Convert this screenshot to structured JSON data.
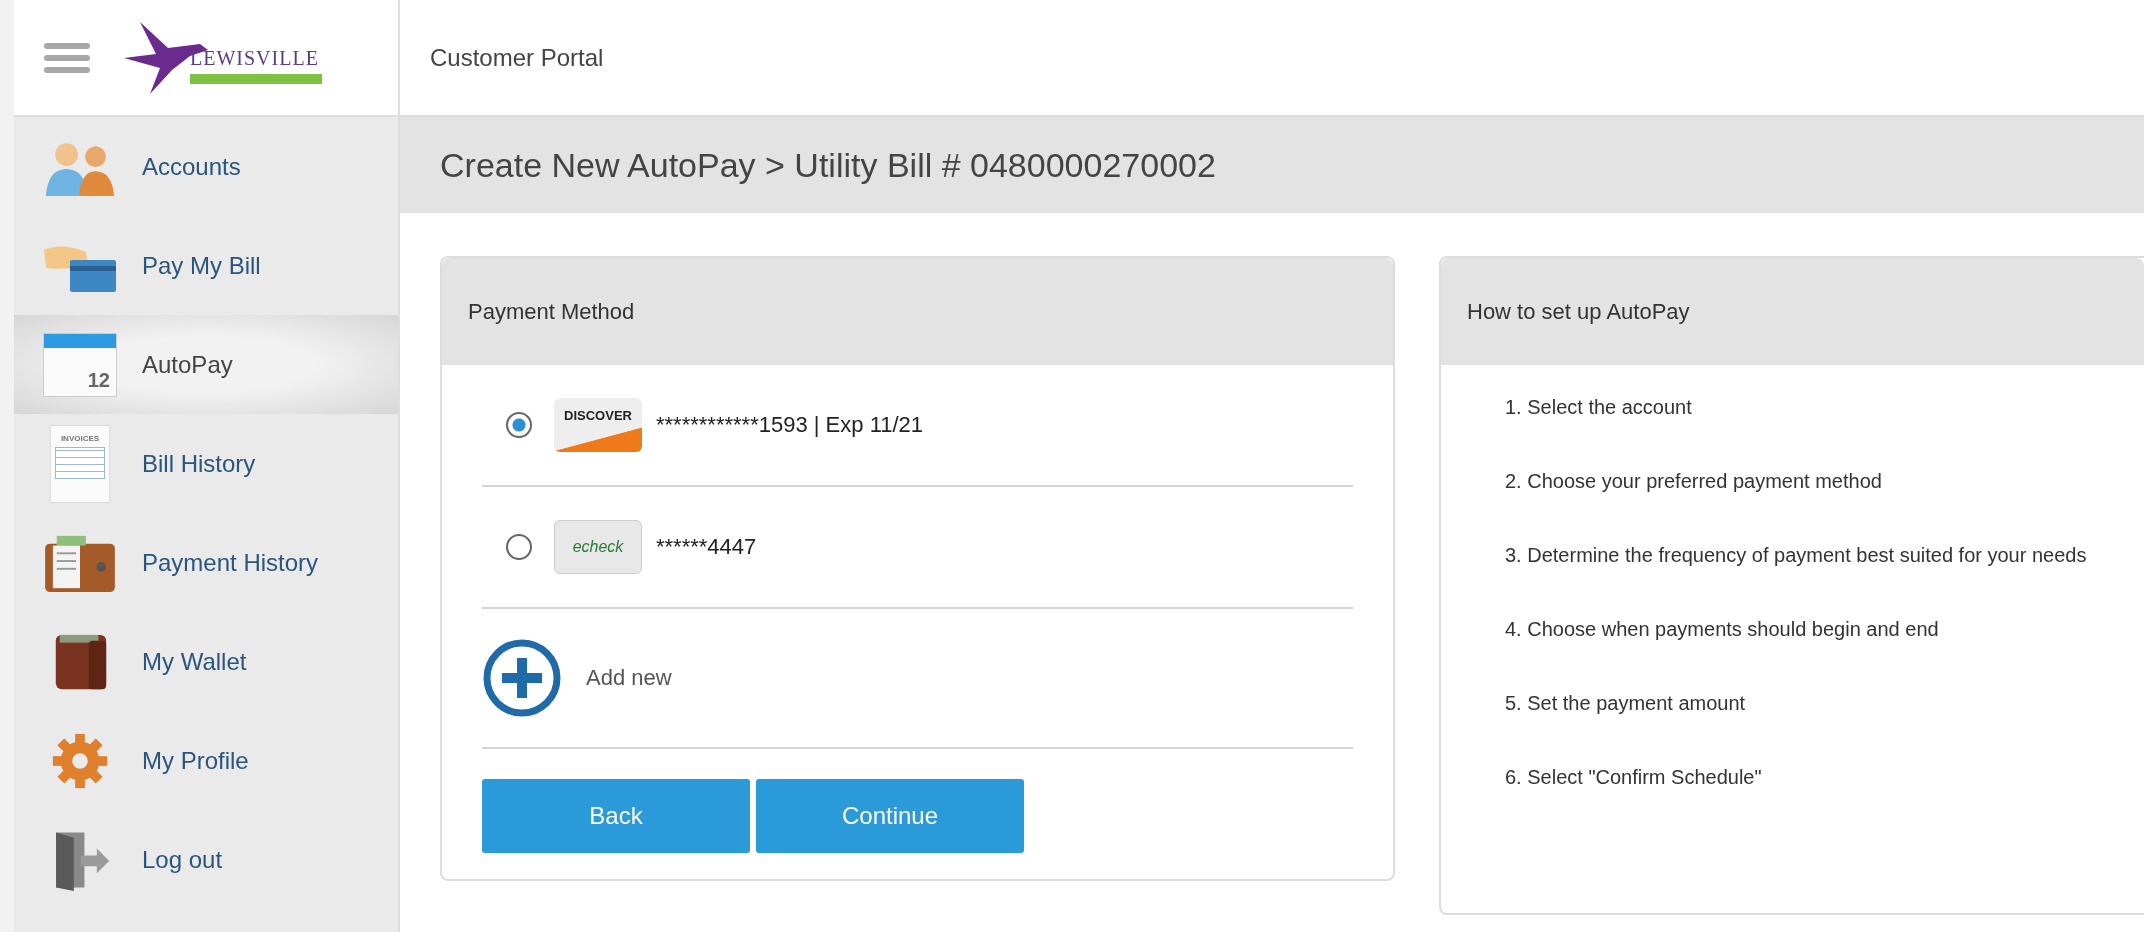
{
  "header": {
    "logo_text": "LEWISVILLE",
    "portal_title": "Customer Portal"
  },
  "sidebar": {
    "items": [
      {
        "label": "Accounts",
        "kind": "people",
        "selected": false
      },
      {
        "label": "Pay My Bill",
        "kind": "card",
        "selected": false
      },
      {
        "label": "AutoPay",
        "kind": "calendar",
        "selected": true,
        "icon_text": "12"
      },
      {
        "label": "Bill History",
        "kind": "invoice",
        "selected": false,
        "icon_text": "INVOICES"
      },
      {
        "label": "Payment History",
        "kind": "receipt",
        "selected": false
      },
      {
        "label": "My Wallet",
        "kind": "wallet",
        "selected": false
      },
      {
        "label": "My Profile",
        "kind": "gear",
        "selected": false
      },
      {
        "label": "Log out",
        "kind": "door",
        "selected": false
      }
    ]
  },
  "page_title": "Create New AutoPay > Utility Bill # 0480000270002",
  "payment_card": {
    "title": "Payment Method",
    "methods": [
      {
        "kind": "discover",
        "logo_text": "DISCOVER",
        "label": "************1593 | Exp 11/21",
        "selected": true
      },
      {
        "kind": "echeck",
        "logo_text": "echeck",
        "label": "******4447",
        "selected": false
      }
    ],
    "add_new": "Add new",
    "buttons": [
      "Back",
      "Continue"
    ]
  },
  "howto_card": {
    "title": "How to set up AutoPay",
    "steps": [
      "1. Select the account",
      "2. Choose your preferred payment method",
      "3. Determine the frequency of payment best suited for your needs",
      "4. Choose when payments should begin and end",
      "5. Set the payment amount",
      "6. Select \"Confirm Schedule\""
    ]
  }
}
